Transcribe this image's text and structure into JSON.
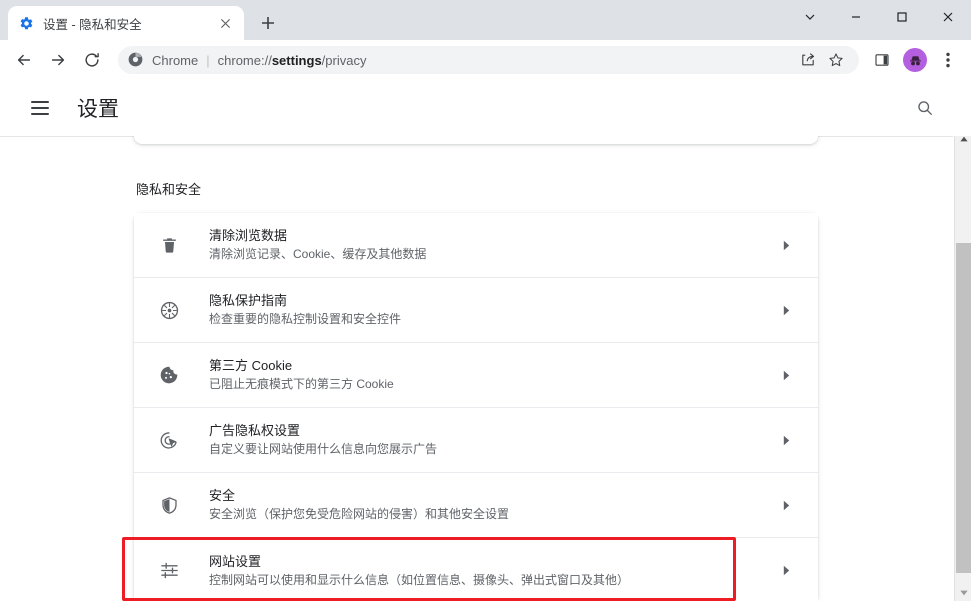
{
  "window": {
    "controls": [
      {
        "name": "tab-search",
        "glyph": "⌄"
      },
      {
        "name": "minimize",
        "glyph": "—"
      },
      {
        "name": "maximize",
        "glyph": "□"
      },
      {
        "name": "close",
        "glyph": "✕"
      }
    ]
  },
  "tab": {
    "title": "设置 - 隐私和安全",
    "favicon": "gear-icon",
    "close_label": "✕",
    "newtab_label": "+"
  },
  "toolbar": {
    "back_label": "←",
    "forward_label": "→",
    "reload_label": "⟳",
    "omnibox": {
      "scheme_label": "Chrome",
      "separator": "|",
      "url_prefix": "chrome://",
      "url_bold": "settings",
      "url_suffix": "/privacy",
      "full_url": "chrome://settings/privacy"
    },
    "share_icon": "share-icon",
    "bookmark_icon": "star-icon",
    "side_panel_icon": "side-panel-icon",
    "profile_icon": "incognito-avatar-icon",
    "menu_icon": "three-dot-menu-icon"
  },
  "settings": {
    "menu_label": "菜单",
    "title": "设置",
    "search_label": "搜索设置"
  },
  "privacy": {
    "section_title": "隐私和安全",
    "items": [
      {
        "icon": "trash-icon",
        "title": "清除浏览数据",
        "sub": "清除浏览记录、Cookie、缓存及其他数据",
        "arrow": "▸"
      },
      {
        "icon": "privacy-guide-icon",
        "title": "隐私保护指南",
        "sub": "检查重要的隐私控制设置和安全控件",
        "arrow": "▸"
      },
      {
        "icon": "cookie-icon",
        "title": "第三方 Cookie",
        "sub": "已阻止无痕模式下的第三方 Cookie",
        "arrow": "▸"
      },
      {
        "icon": "ad-privacy-icon",
        "title": "广告隐私权设置",
        "sub": "自定义要让网站使用什么信息向您展示广告",
        "arrow": "▸"
      },
      {
        "icon": "shield-icon",
        "title": "安全",
        "sub": "安全浏览（保护您免受危险网站的侵害）和其他安全设置",
        "arrow": "▸"
      },
      {
        "icon": "tune-icon",
        "title": "网站设置",
        "sub": "控制网站可以使用和显示什么信息（如位置信息、摄像头、弹出式窗口及其他）",
        "arrow": "▸"
      }
    ]
  },
  "highlight": {
    "target": "网站设置",
    "color": "#ee1c25"
  },
  "scrollbar": {
    "up_glyph": "▲",
    "down_glyph": "▼"
  },
  "colors": {
    "tabstrip_bg": "#dee1e6",
    "accent_blue": "#1a73e8",
    "avatar_purple": "#b45ee0",
    "text_primary": "#202124",
    "text_secondary": "#5f6368"
  }
}
